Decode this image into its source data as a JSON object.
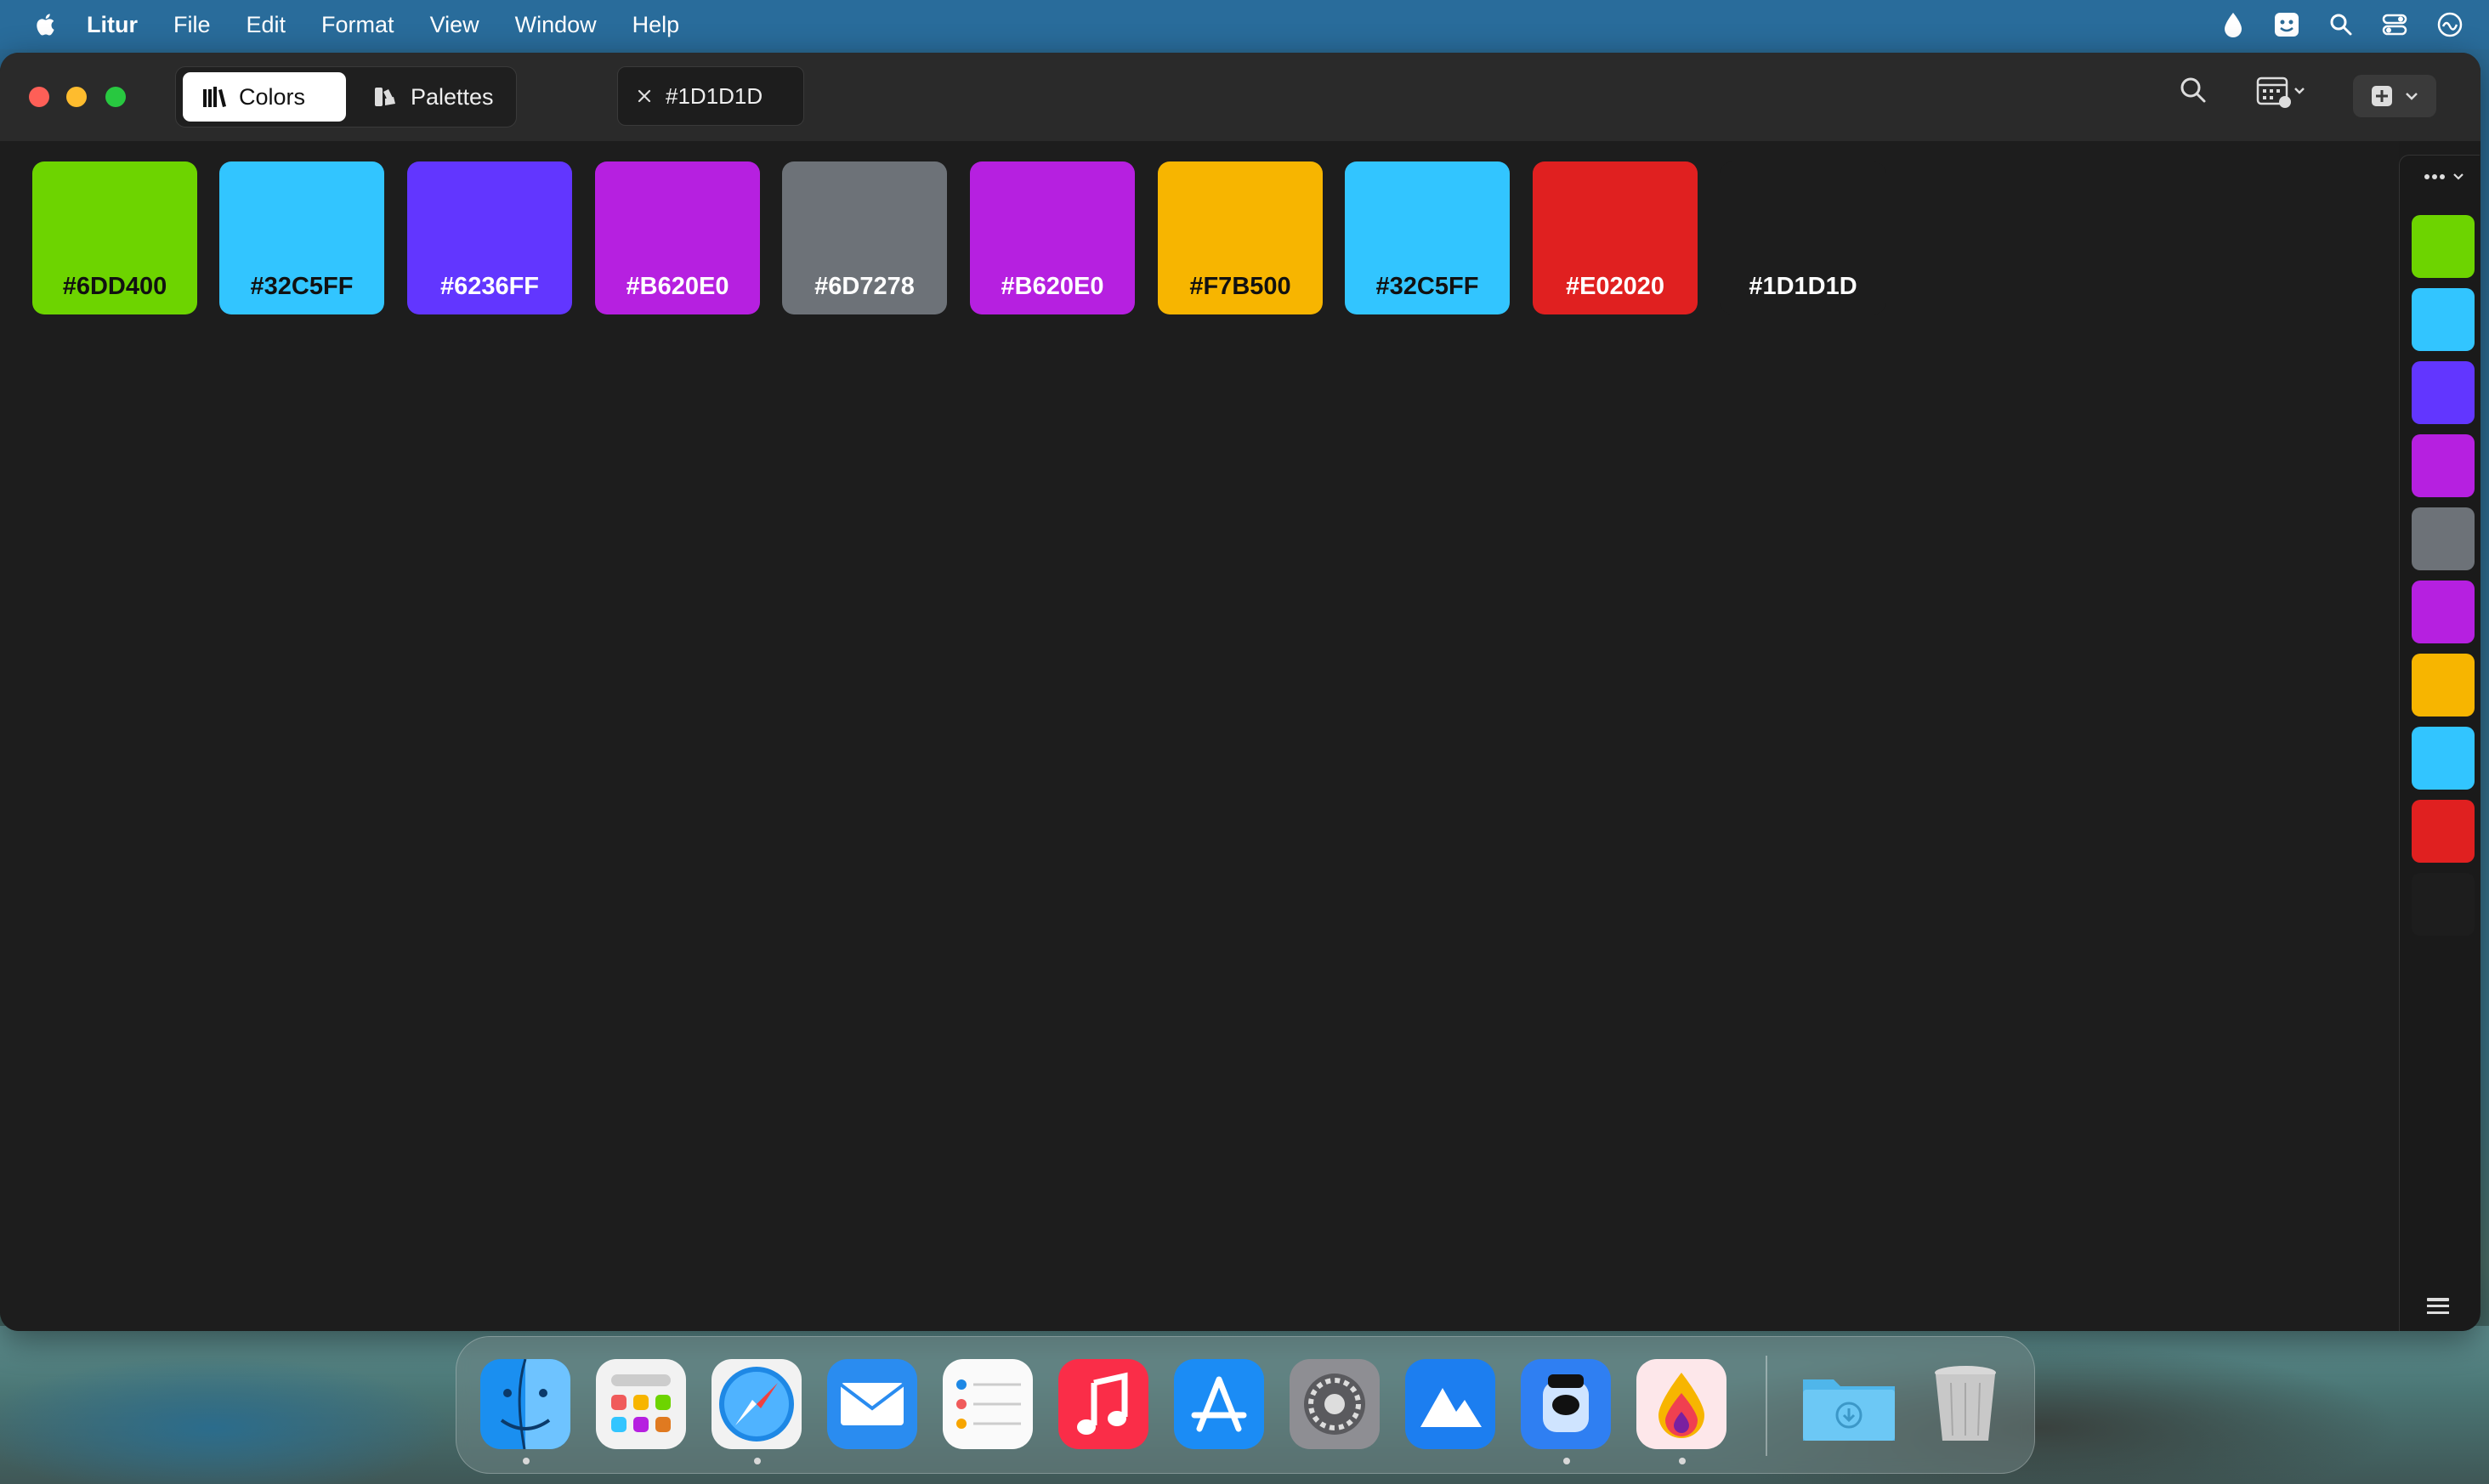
{
  "menubar": {
    "app_name": "Litur",
    "menus": [
      "File",
      "Edit",
      "Format",
      "View",
      "Window",
      "Help"
    ]
  },
  "toolbar": {
    "segments": [
      {
        "label": "Colors",
        "active": true
      },
      {
        "label": "Palettes",
        "active": false
      }
    ],
    "open_tab_label": "#1D1D1D"
  },
  "colors": [
    {
      "hex": "#6DD400",
      "label": "#6DD400",
      "text_color": "#111111"
    },
    {
      "hex": "#32C5FF",
      "label": "#32C5FF",
      "text_color": "#111111"
    },
    {
      "hex": "#6236FF",
      "label": "#6236FF",
      "text_color": "#FFFFFF"
    },
    {
      "hex": "#B620E0",
      "label": "#B620E0",
      "text_color": "#FFFFFF"
    },
    {
      "hex": "#6D7278",
      "label": "#6D7278",
      "text_color": "#FFFFFF"
    },
    {
      "hex": "#B620E0",
      "label": "#B620E0",
      "text_color": "#FFFFFF"
    },
    {
      "hex": "#F7B500",
      "label": "#F7B500",
      "text_color": "#111111"
    },
    {
      "hex": "#32C5FF",
      "label": "#32C5FF",
      "text_color": "#111111"
    },
    {
      "hex": "#E02020",
      "label": "#E02020",
      "text_color": "#FFFFFF"
    },
    {
      "hex": "#1D1D1D",
      "label": "#1D1D1D",
      "text_color": "#FFFFFF"
    }
  ],
  "rail_colors": [
    "#6DD400",
    "#32C5FF",
    "#6236FF",
    "#B620E0",
    "#6D7278",
    "#B620E0",
    "#F7B500",
    "#32C5FF",
    "#E02020",
    "#1D1D1D"
  ],
  "dock": {
    "apps": [
      {
        "icon": "finder-icon",
        "running": true
      },
      {
        "icon": "launchpad-icon",
        "running": false
      },
      {
        "icon": "safari-icon",
        "running": true
      },
      {
        "icon": "mail-icon",
        "running": false
      },
      {
        "icon": "reminders-icon",
        "running": false
      },
      {
        "icon": "music-icon",
        "running": false
      },
      {
        "icon": "app-store-icon",
        "running": false
      },
      {
        "icon": "system-settings-icon",
        "running": false
      },
      {
        "icon": "mountain-app-icon",
        "running": false
      },
      {
        "icon": "preview-jar-icon",
        "running": true
      },
      {
        "icon": "litur-icon",
        "running": true
      }
    ],
    "stacks": [
      {
        "icon": "downloads-folder-icon"
      },
      {
        "icon": "trash-icon"
      }
    ]
  }
}
